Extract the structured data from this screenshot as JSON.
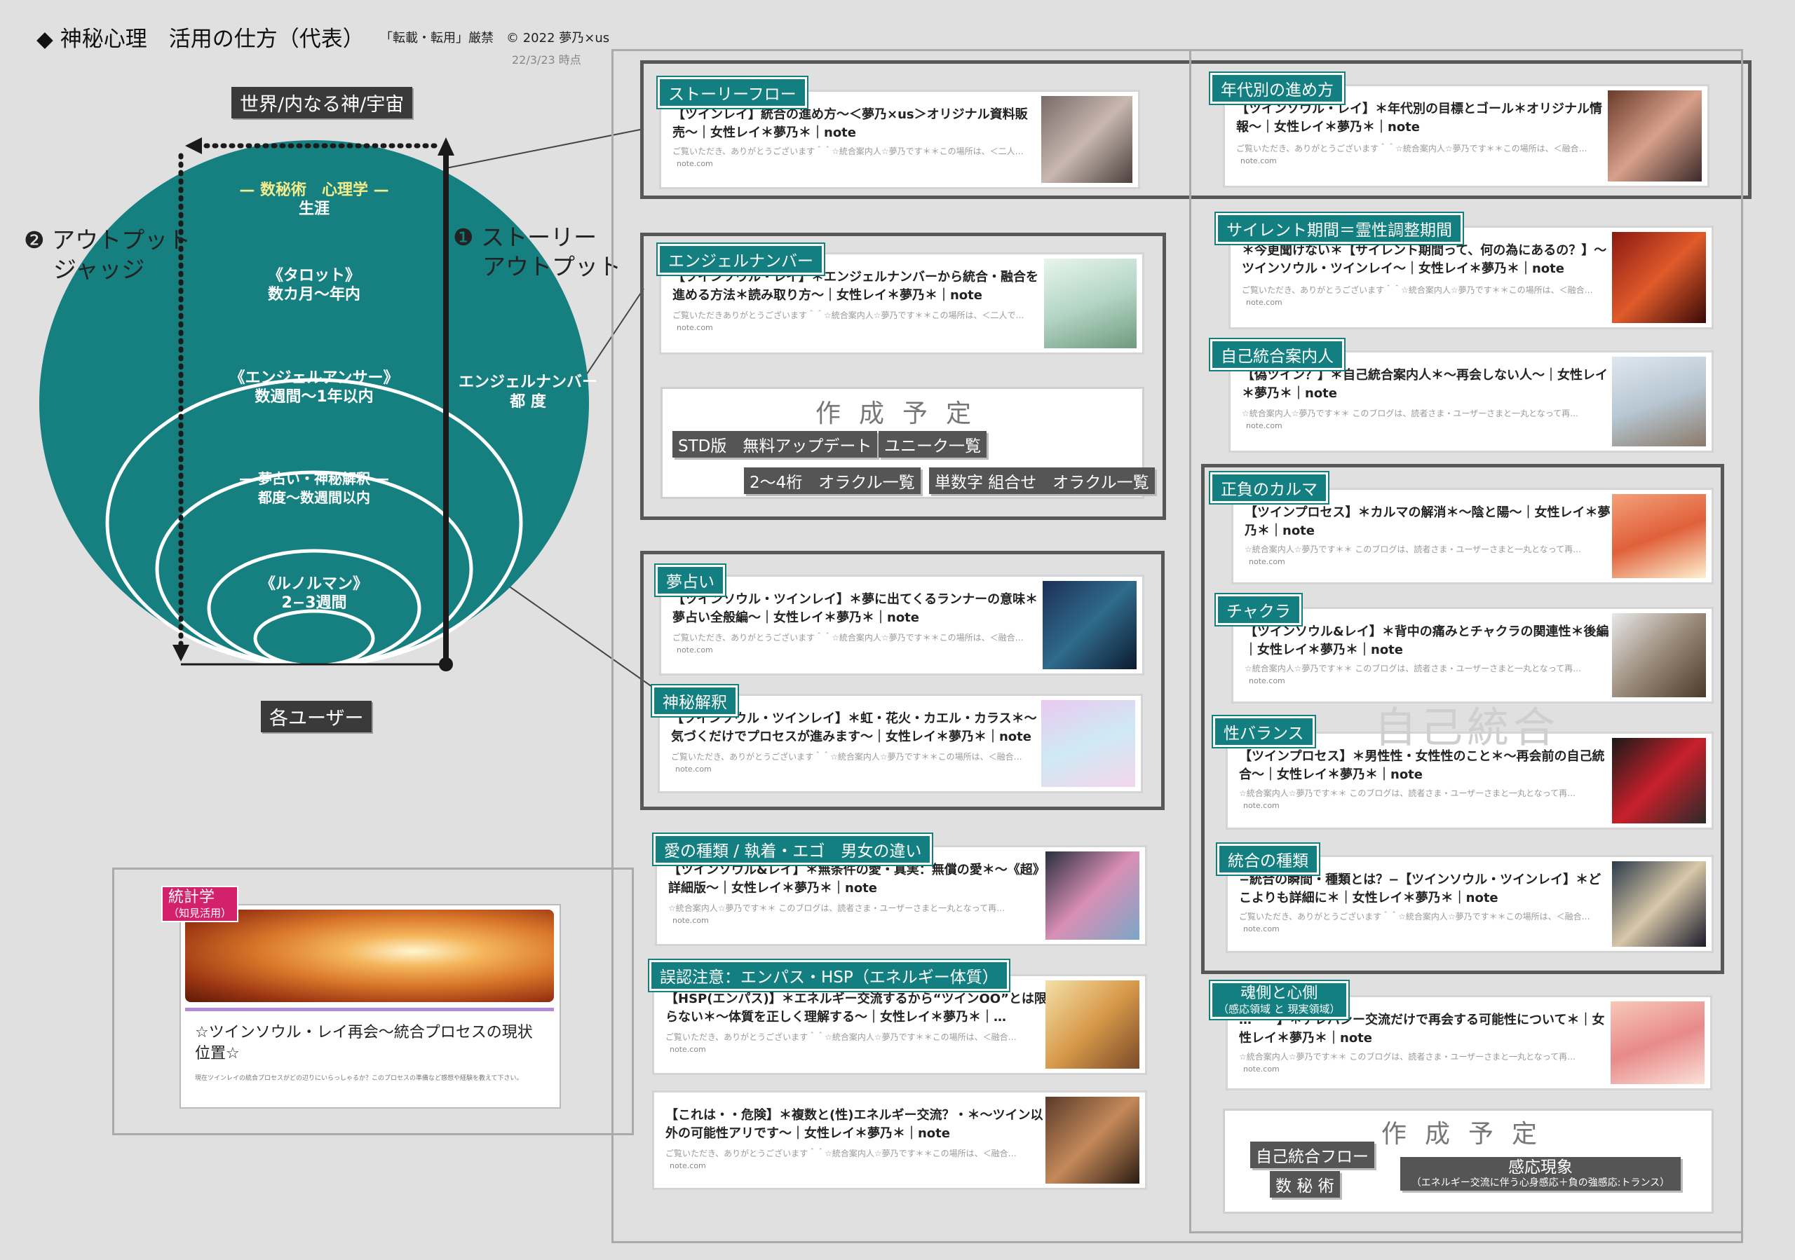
{
  "header": {
    "title": "◆ 神秘心理　活用の仕方（代表）",
    "copyright": "「転載・転用」厳禁　© 2022 夢乃×us",
    "date": "22/3/23 時点"
  },
  "diagram": {
    "top_label": "世界/内なる神/宇宙",
    "bottom_label": "各ユーザー",
    "left_label_1": "❷ アウトプット",
    "left_label_2": "ジャッジ",
    "right_label_1": "❶ ストーリー",
    "right_label_2": "アウトプット",
    "angel_label_1": "エンジェルナンバー",
    "angel_label_2": "都 度",
    "circles": [
      {
        "title": "— 数秘術　心理学 —",
        "period": "生涯"
      },
      {
        "title": "《タロット》",
        "period": "数カ月〜年内"
      },
      {
        "title": "《エンジェルアンサー》",
        "period": "数週間〜1年以内"
      },
      {
        "title": "— 夢占い・神秘解釈 —",
        "period": "都度〜数週間以内"
      },
      {
        "title": "《ルノルマン》",
        "period": "2−3週間"
      }
    ],
    "colors": {
      "circle": "#167f80",
      "highlight": "#f3ec8a"
    }
  },
  "stats": {
    "tag": "統計学",
    "sub": "（知見活用）",
    "card_title": "☆ツインソウル・レイ再会〜統合プロセスの現状位置☆",
    "card_desc": "現在ツインレイの統合プロセスがどの辺りにいらっしゃるか？このプロセスの準備など感想や経験を教えて下さい。"
  },
  "middle": {
    "story": {
      "tag": "ストーリーフロー",
      "title": "【ツインレイ】統合の進め方〜＜夢乃×us＞オリジナル資料販売〜｜女性レイ＊夢乃＊｜note",
      "desc": "ご覧いただき、ありがとうございます＾＾☆統合案内人☆夢乃です＊＊この場所は、＜二人…",
      "site": "note.com"
    },
    "angel": {
      "tag": "エンジェルナンバー",
      "title": "【ツインソウル・レイ】＊エンジェルナンバーから統合・融合を進める方法＊読み取り方〜｜女性レイ＊夢乃＊｜note",
      "desc": "ご覧いただきありがとうございます＾＾☆統合案内人☆夢乃です＊＊この場所は、＜二人で…",
      "site": "note.com"
    },
    "plan": {
      "title": "作成予定",
      "buttons": [
        "STD版　無料アップデート",
        "ユニーク一覧",
        "2〜4桁　オラクル一覧",
        "単数字 組合せ　オラクル一覧"
      ]
    },
    "dream": {
      "tag": "夢占い",
      "title": "【ツインソウル・ツインレイ】＊夢に出てくるランナーの意味＊夢占い全般編〜｜女性レイ＊夢乃＊｜note",
      "desc": "ご覧いただき、ありがとうございます＾＾☆統合案内人☆夢乃です＊＊この場所は、＜融合…",
      "site": "note.com"
    },
    "mystic": {
      "tag": "神秘解釈",
      "title": "【ツインソウル・ツインレイ】＊虹・花火・カエル・カラス＊〜気づくだけでプロセスが進みます〜｜女性レイ＊夢乃＊｜note",
      "desc": "ご覧いただき、ありがとうございます＾＾☆統合案内人☆夢乃です＊＊この場所は、＜融合…",
      "site": "note.com"
    },
    "love": {
      "tag": "愛の種類 / 執着・エゴ　男女の違い",
      "title": "【ツインソウル&レイ】＊無条件の愛・真実：無償の愛＊〜《超》詳細版〜｜女性レイ＊夢乃＊｜note",
      "desc": "☆統合案内人☆夢乃です＊＊ このブログは、読者さま・ユーザーさまと一丸となって再…",
      "site": "note.com"
    },
    "hsp": {
      "tag": "誤認注意：エンパス・HSP（エネルギー体質）",
      "title": "【HSP(エンパス)】＊エネルギー交流するから“ツインOO”とは限らない＊〜体質を正しく理解する〜｜女性レイ＊夢乃＊｜…",
      "desc": "ご覧いただき、ありがとうございます＾＾☆統合案内人☆夢乃です＊＊この場所は、＜融合…",
      "site": "note.com"
    },
    "danger": {
      "title": "【これは・・危険】＊複数と(性)エネルギー交流？・＊〜ツイン以外の可能性アリです〜｜女性レイ＊夢乃＊｜note",
      "desc": "ご覧いただき、ありがとうございます＾＾☆統合案内人☆夢乃です＊＊この場所は、＜融合…",
      "site": "note.com"
    }
  },
  "right": {
    "age": {
      "tag": "年代別の進め方",
      "title": "【ツインソウル・レイ】＊年代別の目標とゴール＊オリジナル情報〜｜女性レイ＊夢乃＊｜note",
      "desc": "ご覧いただき、ありがとうございます＾＾☆統合案内人☆夢乃です＊＊この場所は、＜融合…",
      "site": "note.com"
    },
    "silent": {
      "tag": "サイレント期間＝霊性調整期間",
      "title": "＊今更聞けない＊【サイレント期間って、何の為にあるの？】〜ツインソウル・ツインレイ〜｜女性レイ＊夢乃＊｜note",
      "desc": "ご覧いただき、ありがとうございます＾＾☆統合案内人☆夢乃です＊＊この場所は、＜融合…",
      "site": "note.com"
    },
    "guide": {
      "tag": "自己統合案内人",
      "title": "【偽ツイン？】＊自己統合案内人＊〜再会しない人〜｜女性レイ＊夢乃＊｜note",
      "desc": "☆統合案内人☆夢乃です＊＊ このブログは、読者さま・ユーザーさまと一丸となって再…",
      "site": "note.com"
    },
    "karma": {
      "tag": "正負のカルマ",
      "title": "【ツインプロセス】＊カルマの解消＊〜陰と陽〜｜女性レイ＊夢乃＊｜note",
      "desc": "☆統合案内人☆夢乃です＊＊ このブログは、読者さま・ユーザーさまと一丸となって再…",
      "site": "note.com"
    },
    "chakra": {
      "tag": "チャクラ",
      "title": "【ツインソウル&レイ】＊背中の痛みとチャクラの関連性＊後編｜女性レイ＊夢乃＊｜note",
      "desc": "☆統合案内人☆夢乃です＊＊ このブログは、読者さま・ユーザーさまと一丸となって再…",
      "site": "note.com"
    },
    "balance": {
      "tag": "性バランス",
      "title": "【ツインプロセス】＊男性性・女性性のこと＊〜再会前の自己統合〜｜女性レイ＊夢乃＊｜note",
      "desc": "☆統合案内人☆夢乃です＊＊ このブログは、読者さま・ユーザーさまと一丸となって再…",
      "site": "note.com"
    },
    "watermark": "自己統合",
    "integration": {
      "tag": "統合の種類",
      "title": "−統合の瞬間・種類とは？−【ツインソウル・ツインレイ】＊どこよりも詳細に＊｜女性レイ＊夢乃＊｜note",
      "desc": "ご覧いただき、ありがとうございます＾＾☆統合案内人☆夢乃です＊＊この場所は、＜融合…",
      "site": "note.com"
    },
    "soul": {
      "tag": "魂側と心側",
      "sub": "（感応領域 と 現実領域）",
      "title_partial": "…・・】＊テレパシー交流だけで再会する可能性について＊｜女性レイ＊夢乃＊｜note",
      "desc": "☆統合案内人☆夢乃です＊＊ このブログは、読者さま・ユーザーさまと一丸となって再…",
      "site": "note.com"
    },
    "plan": {
      "title": "作成予定",
      "flow": "自己統合フロー",
      "num": "数 秘 術",
      "phen": "感応現象",
      "phen_sub": "（エネルギー交流に伴う心身感応＋負の強感応:トランス）"
    }
  }
}
